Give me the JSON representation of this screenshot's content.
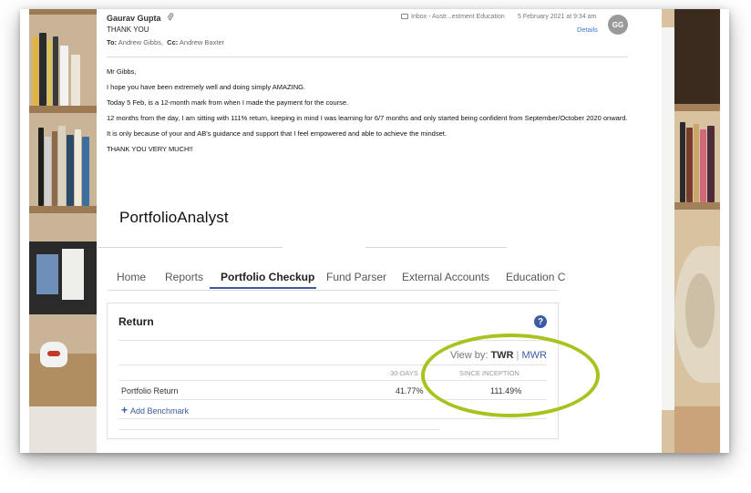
{
  "email": {
    "sender": "Gaurav Gupta",
    "subject": "THANK YOU",
    "to_label": "To:",
    "to": "Andrew Gibbs,",
    "cc_label": "Cc:",
    "cc": "Andrew Baxter",
    "mailbox": "Inbox - Austr...estment Education",
    "date": "5 February 2021 at 9:34 am",
    "details_link": "Details",
    "avatar_initials": "GG",
    "body": [
      "Mr Gibbs,",
      "I hope you have been extremely well and doing simply AMAZING.",
      "Today 5 Feb, is a 12-month mark from when I made the payment for the course.",
      "12 months from the day, I am sitting with 111% return, keeping in mind I was learning for 6/7 months and only started being confident from September/October 2020 onward.",
      "It is only because of your and AB's guidance and support that I feel empowered and able to achieve the mindset.",
      "THANK YOU VERY MUCH!!"
    ]
  },
  "portfolio": {
    "logo": "PortfolioAnalyst",
    "tabs": [
      "Home",
      "Reports",
      "Portfolio Checkup",
      "Fund Parser",
      "External Accounts",
      "Education C"
    ],
    "active_tab": "Portfolio Checkup",
    "card": {
      "title": "Return",
      "help_icon": "?",
      "view_by_label": "View by:",
      "view_twr": "TWR",
      "view_sep": "|",
      "view_mwr": "MWR",
      "col_30": "30-DAYS",
      "col_since": "SINCE INCEPTION",
      "row_label": "Portfolio Return",
      "value_30": "41.77%",
      "value_since": "111.49%",
      "add_benchmark": "Add Benchmark"
    }
  },
  "colors": {
    "accent_blue": "#3b5ba3",
    "highlight_green": "#a7c31f",
    "link_blue": "#3a7bd5"
  },
  "icons": {
    "attachment": "paperclip-icon",
    "inbox": "inbox-icon",
    "help": "help-icon",
    "add": "plus-icon"
  }
}
